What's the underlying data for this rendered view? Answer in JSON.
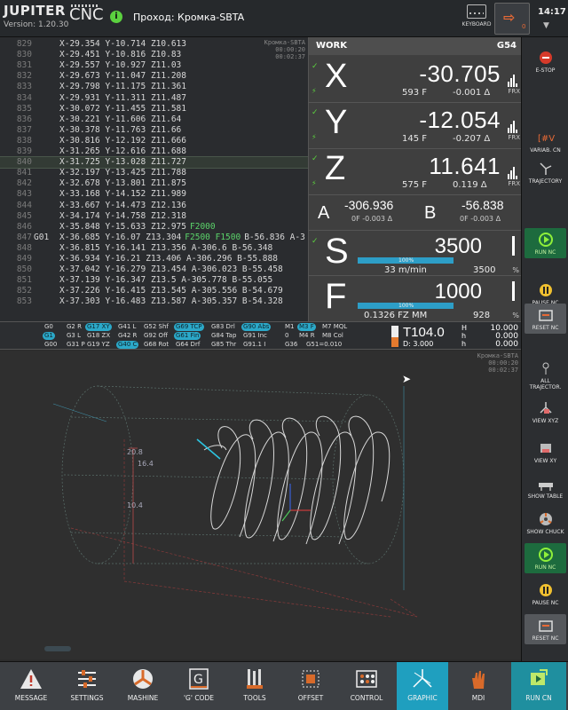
{
  "header": {
    "brand": "JUPITER",
    "version": "Version:  1.20.30",
    "cnc": "CNC",
    "info_icon": "i",
    "program_name": "Проход: Кромка-SBTA",
    "keyboard_label": "KEYBOARD",
    "login_count": "0",
    "clock": "14:17",
    "clock_arrow": "▼"
  },
  "code": {
    "meta": [
      "Кромка-SBTA",
      "00:00:20",
      "00:02:37"
    ],
    "lines": [
      {
        "n": "829",
        "t": "X-29.354 Y-10.714 Z10.613"
      },
      {
        "n": "830",
        "t": "X-29.451 Y-10.816 Z10.83"
      },
      {
        "n": "831",
        "t": "X-29.557 Y-10.927 Z11.03"
      },
      {
        "n": "832",
        "t": "X-29.673 Y-11.047 Z11.208"
      },
      {
        "n": "833",
        "t": "X-29.798 Y-11.175 Z11.361"
      },
      {
        "n": "834",
        "t": "X-29.931 Y-11.311 Z11.487"
      },
      {
        "n": "835",
        "t": "X-30.072 Y-11.455 Z11.581"
      },
      {
        "n": "836",
        "t": "X-30.221 Y-11.606 Z11.64"
      },
      {
        "n": "837",
        "t": "X-30.378 Y-11.763 Z11.66"
      },
      {
        "n": "838",
        "t": "X-30.816 Y-12.192 Z11.666"
      },
      {
        "n": "839",
        "t": "X-31.265 Y-12.616 Z11.688"
      },
      {
        "n": "840",
        "t": "X-31.725 Y-13.028 Z11.727"
      },
      {
        "n": "841",
        "t": "X-32.197 Y-13.425 Z11.788"
      },
      {
        "n": "842",
        "t": "X-32.678 Y-13.801 Z11.875"
      },
      {
        "n": "843",
        "t": "X-33.168 Y-14.152 Z11.989"
      },
      {
        "n": "844",
        "t": "X-33.667 Y-14.473 Z12.136"
      },
      {
        "n": "845",
        "t": "X-34.174 Y-14.758 Z12.318"
      },
      {
        "n": "846",
        "t": "X-35.848 Y-15.633 Z12.975",
        "f": "F2000"
      },
      {
        "n": "847",
        "g": "G01",
        "t": "X-36.685 Y-16.07 Z13.304",
        "f": "F2500 F1500",
        "t2": "B-56.836 A-3"
      },
      {
        "n": "848",
        "t": "X-36.815 Y-16.141 Z13.356 A-306.6 B-56.348"
      },
      {
        "n": "849",
        "t": "X-36.934 Y-16.21 Z13.406 A-306.296 B-55.888"
      },
      {
        "n": "850",
        "t": "X-37.042 Y-16.279 Z13.454 A-306.023 B-55.458"
      },
      {
        "n": "851",
        "t": "X-37.139 Y-16.347 Z13.5 A-305.778 B-55.055"
      },
      {
        "n": "852",
        "t": "X-37.226 Y-16.415 Z13.545 A-305.556 B-54.679"
      },
      {
        "n": "853",
        "t": "X-37.303 Y-16.483 Z13.587 A-305.357 B-54.328"
      }
    ],
    "active_line": "840"
  },
  "work": {
    "title": "WORK",
    "cs": "G54",
    "axes": [
      {
        "l": "X",
        "v": "-30.705",
        "f": "593 F",
        "d": "-0.001 Δ",
        "u": "FRX"
      },
      {
        "l": "Y",
        "v": "-12.054",
        "f": "145 F",
        "d": "-0.207 Δ",
        "u": "FRX"
      },
      {
        "l": "Z",
        "v": "11.641",
        "f": "575 F",
        "d": "0.119 Δ",
        "u": "FRX"
      }
    ],
    "a": {
      "l": "A",
      "v": "-306.936",
      "s": "0F  -0.003 Δ"
    },
    "b": {
      "l": "B",
      "v": "-56.838",
      "s": "0F  -0.003 Δ"
    },
    "spindle": {
      "l": "S",
      "v": "3500",
      "pct": "100%",
      "sub": "33 m/min",
      "sub2": "3500",
      "pc": "%",
      "fill": 1.0
    },
    "feed": {
      "l": "F",
      "v": "1000",
      "pct": "100%",
      "sub": "0.1326 FZ MM",
      "sub2": "928",
      "pc": "%",
      "fill": 1.0
    }
  },
  "modal": {
    "codes": [
      {
        "t": "G0"
      },
      {
        "t": "G2 R"
      },
      {
        "t": "G17 XY",
        "on": true
      },
      {
        "t": "G41 L"
      },
      {
        "t": "G52 Shf"
      },
      {
        "t": "G69 TCP",
        "on": true
      },
      {
        "t": "G83 Drl"
      },
      {
        "t": "G90 Abs",
        "on": true
      },
      {
        "t": "M1"
      },
      {
        "t": "M3 F",
        "on": true
      },
      {
        "t": "M7 MQL"
      },
      {
        "t": "G1",
        "on": true
      },
      {
        "t": "G3 L"
      },
      {
        "t": "G18 ZX"
      },
      {
        "t": "G42 R"
      },
      {
        "t": "G92 Off"
      },
      {
        "t": "G61 Fin",
        "on": true
      },
      {
        "t": "G84 Tap"
      },
      {
        "t": "G91 Inc"
      },
      {
        "t": "0"
      },
      {
        "t": "M4 R"
      },
      {
        "t": "M8 Col"
      },
      {
        "t": "G00"
      },
      {
        "t": "G31 P"
      },
      {
        "t": "G19 YZ"
      },
      {
        "t": "G40 C",
        "on": true
      },
      {
        "t": "G68 Rot"
      },
      {
        "t": "G64 Drf"
      },
      {
        "t": "G85 Thr"
      },
      {
        "t": "G91.1 I"
      },
      {
        "t": "G36"
      },
      {
        "t": "G51=0.010"
      }
    ],
    "tool": "T104.0",
    "diam": "D: 3.000",
    "h_label": "H",
    "h_value": "10.000",
    "h2": "0.000",
    "h3": "0.000",
    "r2": "h",
    "r3": "h"
  },
  "graph": {
    "meta": [
      "Кромка-SBTA",
      "00:00:20",
      "00:02:37"
    ],
    "label1": "20.8",
    "label2": "16.4",
    "label3": "10.4"
  },
  "right_panel": [
    {
      "label": "E-STOP",
      "icon": "estop-icon"
    },
    {
      "label": "VARIAB. CN",
      "icon": "variables-icon"
    },
    {
      "label": "TRAJECTORY",
      "icon": "trajectory-icon"
    },
    {
      "label": "RUN NC",
      "icon": "run-icon"
    },
    {
      "label": "PAUSE NC",
      "icon": "pause-icon"
    },
    {
      "label": "RESET NC",
      "icon": "reset-icon"
    },
    {
      "label": "ALL TRAJECTOR.",
      "icon": "all-trajectory-icon"
    },
    {
      "label": "VIEW XYZ",
      "icon": "view-xyz-icon"
    },
    {
      "label": "VIEW XY",
      "icon": "view-xy-icon"
    },
    {
      "label": "SHOW TABLE",
      "icon": "show-table-icon"
    },
    {
      "label": "SHOW CHUCK",
      "icon": "show-chuck-icon"
    },
    {
      "label": "RUN NC",
      "icon": "run-icon"
    },
    {
      "label": "PAUSE NC",
      "icon": "pause-icon"
    },
    {
      "label": "RESET NC",
      "icon": "reset-icon"
    }
  ],
  "bottom_bar": [
    {
      "label": "MESSAGE",
      "icon": "warning-icon"
    },
    {
      "label": "SETTINGS",
      "icon": "sliders-icon"
    },
    {
      "label": "MASHINE",
      "icon": "machine-icon"
    },
    {
      "label": "'G' CODE",
      "icon": "gcode-icon"
    },
    {
      "label": "TOOLS",
      "icon": "tools-icon"
    },
    {
      "label": "OFFSET",
      "icon": "offset-icon"
    },
    {
      "label": "CONTROL",
      "icon": "control-icon"
    },
    {
      "label": "GRAPHIC",
      "icon": "graphic-icon",
      "selected": true
    },
    {
      "label": "MDI",
      "icon": "hand-icon"
    },
    {
      "label": "RUN CN",
      "icon": "run-cn-icon"
    }
  ]
}
